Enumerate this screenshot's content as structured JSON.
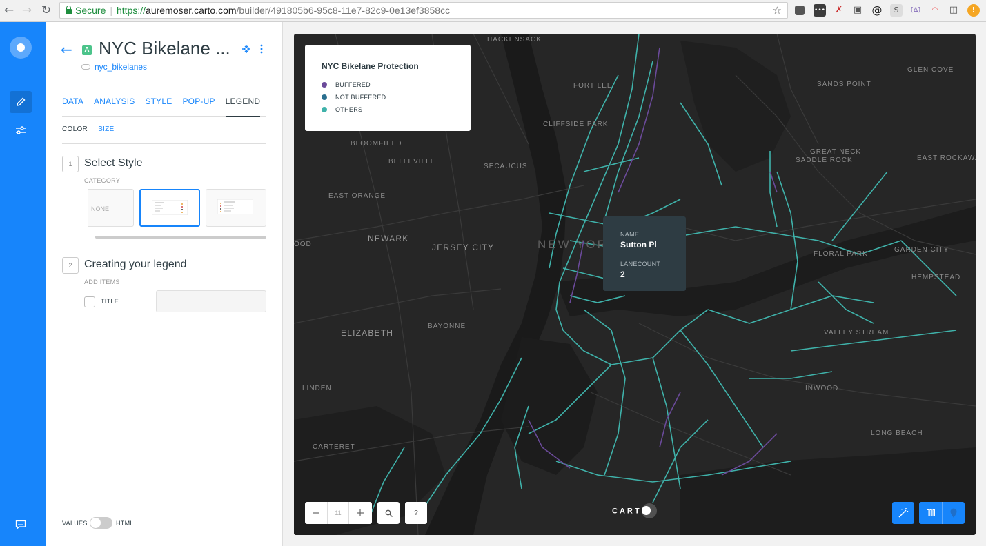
{
  "browser": {
    "secure_label": "Secure",
    "url_proto": "https://",
    "url_host": "auremoser.carto.com",
    "url_path": "/builder/491805b6-95c8-11e7-82c9-0e13ef3858cc"
  },
  "panel": {
    "layer_letter": "A",
    "layer_title": "NYC Bikelane ...",
    "source_name": "nyc_bikelanes",
    "tabs": [
      "DATA",
      "ANALYSIS",
      "STYLE",
      "POP-UP",
      "LEGEND"
    ],
    "selected_tab": "LEGEND",
    "subtabs": [
      "COLOR",
      "SIZE"
    ],
    "selected_subtab": "COLOR",
    "step1": {
      "num": "1",
      "title": "Select Style",
      "sub": "CATEGORY",
      "none_label": "NONE"
    },
    "step2": {
      "num": "2",
      "title": "Creating your legend",
      "sub": "ADD ITEMS",
      "checkbox_label": "TITLE"
    },
    "values_label": "VALUES",
    "html_label": "HTML"
  },
  "legend": {
    "title": "NYC Bikelane Protection",
    "items": [
      {
        "label": "BUFFERED",
        "color": "#6b4a9a"
      },
      {
        "label": "NOT BUFFERED",
        "color": "#2a6f8f"
      },
      {
        "label": "OTHERS",
        "color": "#3fb2aa"
      }
    ]
  },
  "popup": {
    "fields": [
      {
        "key": "NAME",
        "value": "Sutton Pl"
      },
      {
        "key": "LANECOUNT",
        "value": "2"
      }
    ]
  },
  "map": {
    "zoom_level": "11",
    "help_label": "?",
    "logo": "CART",
    "places": [
      "HACKENSACK",
      "FORT LEE",
      "GLEN COVE",
      "SANDS POINT",
      "CLIFFSIDE PARK",
      "BLOOMFIELD",
      "BELLEVILLE",
      "SECAUCUS",
      "GREAT NECK",
      "SADDLE ROCK",
      "EAST ROCKAWAY",
      "EAST ORANGE",
      "NEWARK",
      "JERSEY CITY",
      "NEW YORK",
      "GARDEN CITY",
      "FLORAL PARK",
      "HEMPSTEAD",
      "BAYONNE",
      "ELIZABETH",
      "VALLEY STREAM",
      "INWOOD",
      "LINDEN",
      "LONG BEACH",
      "CARTERET",
      "OOD"
    ]
  },
  "colors": {
    "accent": "#1785fb",
    "map_bg": "#262626",
    "bikelane_others": "#3fb2aa",
    "bikelane_buffered": "#6b4a9a",
    "popup_bg": "#2e3c43"
  }
}
